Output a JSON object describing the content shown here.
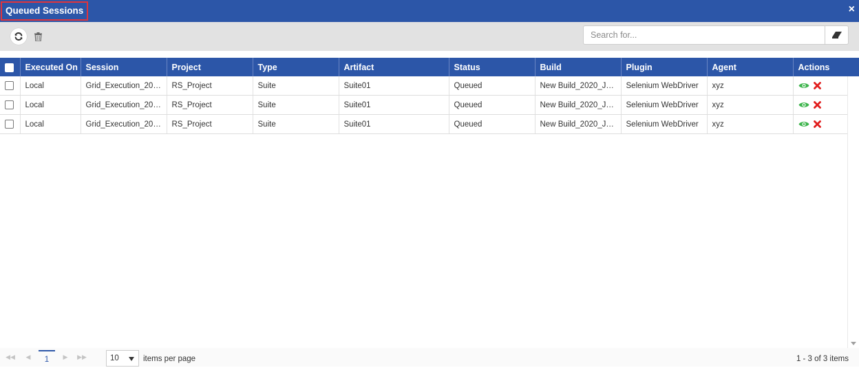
{
  "window": {
    "title": "Queued Sessions",
    "close_glyph": "×"
  },
  "toolbar": {
    "refresh_icon": "refresh-icon",
    "delete_icon": "trash-icon",
    "search_placeholder": "Search for...",
    "clear_icon": "eraser-icon"
  },
  "table": {
    "columns": [
      "Executed On",
      "Session",
      "Project",
      "Type",
      "Artifact",
      "Status",
      "Build",
      "Plugin",
      "Agent",
      "Actions"
    ],
    "rows": [
      {
        "executed_on": "Local",
        "session": "Grid_Execution_2020...",
        "project": "RS_Project",
        "type": "Suite",
        "artifact": "Suite01",
        "status": "Queued",
        "build": "New Build_2020_Jun...",
        "plugin": "Selenium WebDriver",
        "agent": "xyz"
      },
      {
        "executed_on": "Local",
        "session": "Grid_Execution_2020...",
        "project": "RS_Project",
        "type": "Suite",
        "artifact": "Suite01",
        "status": "Queued",
        "build": "New Build_2020_Jun...",
        "plugin": "Selenium WebDriver",
        "agent": "xyz"
      },
      {
        "executed_on": "Local",
        "session": "Grid_Execution_2020...",
        "project": "RS_Project",
        "type": "Suite",
        "artifact": "Suite01",
        "status": "Queued",
        "build": "New Build_2020_Jun...",
        "plugin": "Selenium WebDriver",
        "agent": "xyz"
      }
    ]
  },
  "pager": {
    "current_page": "1",
    "page_size": "10",
    "items_per_page_label": "items per page",
    "items_info": "1 - 3 of 3 items"
  },
  "colors": {
    "header_blue": "#2c56a8",
    "title_outline": "#e2343b",
    "view_green": "#3cb44b",
    "delete_red": "#e11d1d"
  }
}
